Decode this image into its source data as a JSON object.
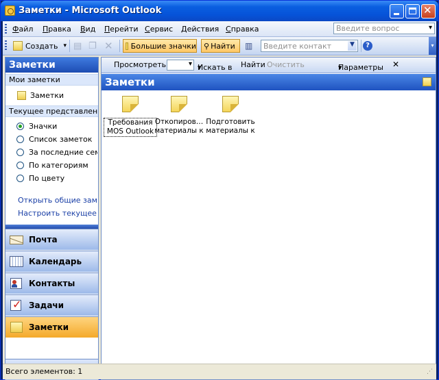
{
  "window": {
    "title": "Заметки - Microsoft Outlook"
  },
  "menu": {
    "items": [
      "Файл",
      "Правка",
      "Вид",
      "Перейти",
      "Сервис",
      "Действия",
      "Справка"
    ],
    "ask_placeholder": "Введите вопрос"
  },
  "toolbar": {
    "new_label": "Создать",
    "large_icons_label": "Большие значки",
    "find_label": "Найти",
    "contact_placeholder": "Введите контакт"
  },
  "nav": {
    "header": "Заметки",
    "my_notes_label": "Мои заметки",
    "notes_folder": "Заметки",
    "current_view_label": "Текущее представление",
    "views": [
      {
        "label": "Значки",
        "selected": true
      },
      {
        "label": "Список заметок",
        "selected": false
      },
      {
        "label": "За последние семь дней",
        "selected": false
      },
      {
        "label": "По категориям",
        "selected": false
      },
      {
        "label": "По цвету",
        "selected": false
      }
    ],
    "links": [
      "Открыть общие заметки",
      "Настроить текущее представление"
    ],
    "buttons": [
      "Почта",
      "Календарь",
      "Контакты",
      "Задачи",
      "Заметки"
    ]
  },
  "findbar": {
    "look_label": "Просмотреть:",
    "search_in_label": "Искать в",
    "find_now": "Найти",
    "clear": "Очистить",
    "options": "Параметры"
  },
  "folder": {
    "title": "Заметки",
    "notes": [
      {
        "caption_1": "Требования",
        "caption_2": "MOS Outlook",
        "selected": true
      },
      {
        "caption_1": "Откопиров…",
        "caption_2": "материалы к",
        "selected": false
      },
      {
        "caption_1": "Подготовить",
        "caption_2": "материалы к",
        "selected": false
      }
    ]
  },
  "status": {
    "text": "Всего элементов: 1"
  }
}
